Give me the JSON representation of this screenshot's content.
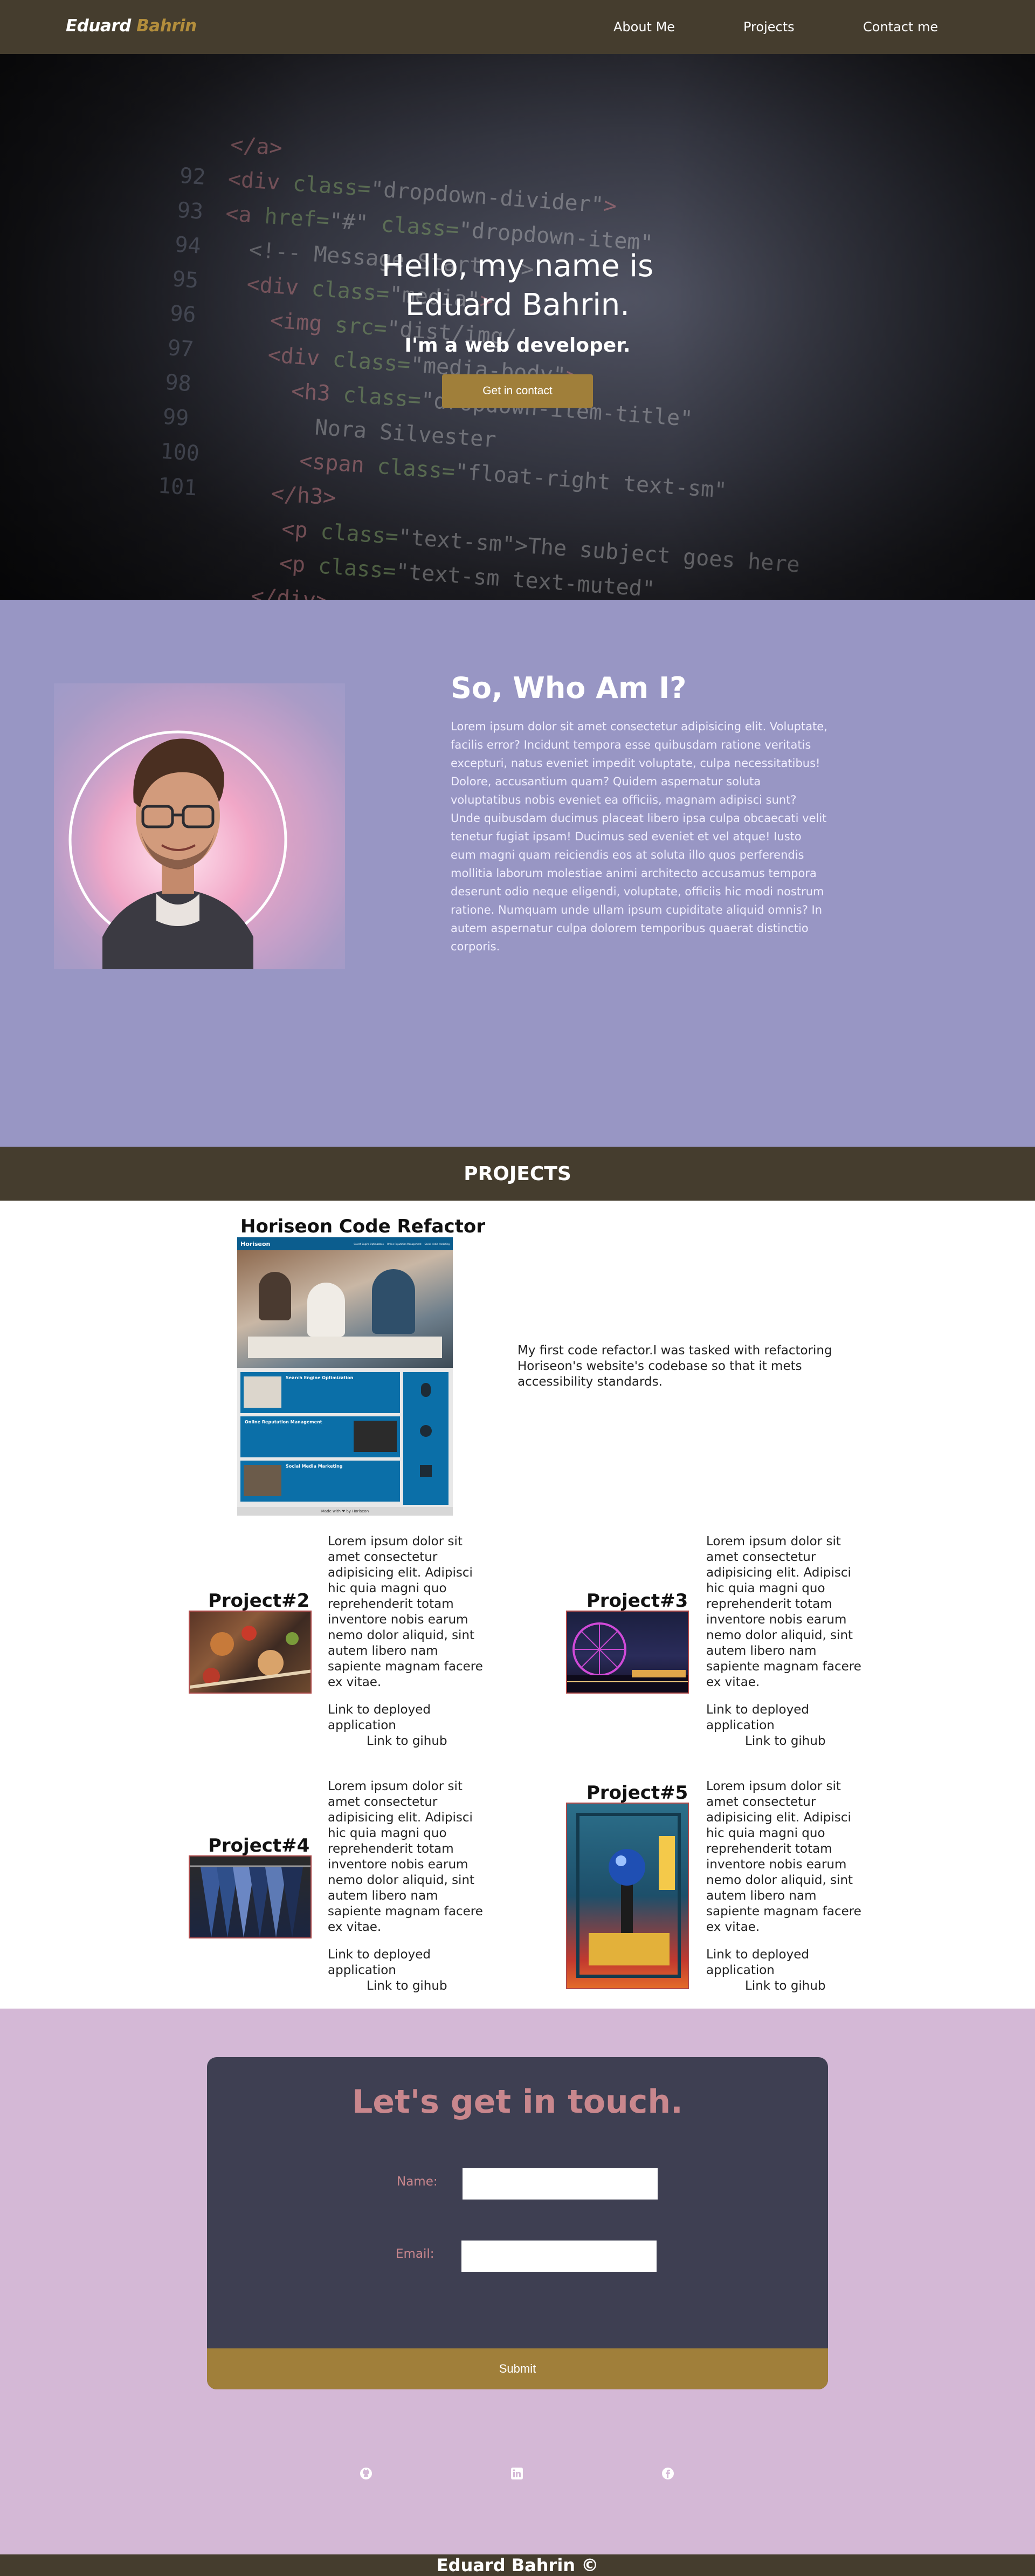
{
  "nav": {
    "brand_first": "Eduard",
    "brand_last": "Bahrin",
    "links": [
      "About Me",
      "Projects",
      "Contact me"
    ]
  },
  "hero": {
    "title_line1": "Hello, my name is",
    "title_line2": "Eduard Bahrin.",
    "subtitle": "I'm a web developer.",
    "cta": "Get in contact"
  },
  "about": {
    "title": "So, Who Am I?",
    "body": "Lorem ipsum dolor sit amet consectetur adipisicing elit. Voluptate, facilis error? Incidunt tempora esse quibusdam ratione veritatis excepturi, natus eveniet impedit voluptate, culpa necessitatibus! Dolore, accusantium quam? Quidem aspernatur soluta voluptatibus nobis eveniet ea officiis, magnam adipisci sunt? Unde quibusdam ducimus placeat libero ipsa culpa obcaecati velit tenetur fugiat ipsam! Ducimus sed eveniet et vel atque! Iusto eum magni quam reiciendis eos at soluta illo quos perferendis mollitia laborum molestiae animi architecto accusamus tempora deserunt odio neque eligendi, voluptate, officiis hic modi nostrum ratione. Numquam unde ullam ipsum cupiditate aliquid omnis? In autem aspernatur culpa dolorem temporibus quaerat distinctio corporis."
  },
  "projects": {
    "section_title": "PROJECTS",
    "featured": {
      "title": "Horiseon Code Refactor",
      "description": "My first code refactor.I was tasked with refactoring Horiseon's website's codebase so that it mets accessibility standards.",
      "screenshot": {
        "logo": "Horiseon",
        "nav": [
          "Search Engine Optimization",
          "Online Reputation Management",
          "Social Media Marketing"
        ],
        "cards": [
          "Search Engine Optimization",
          "Online Reputation Management",
          "Social Media Marketing"
        ],
        "footer": "Made with ❤ by Horiseon"
      }
    },
    "items": [
      {
        "title": "Project#2",
        "description": "Lorem ipsum dolor sit amet consectetur adipisicing elit. Adipisci hic quia magni quo reprehenderit totam inventore nobis earum nemo dolor aliquid, sint autem libero nam sapiente magnam facere ex vitae.",
        "link_deployed": "Link to deployed application",
        "link_github": "Link to gihub"
      },
      {
        "title": "Project#3",
        "description": "Lorem ipsum dolor sit amet consectetur adipisicing elit. Adipisci hic quia magni quo reprehenderit totam inventore nobis earum nemo dolor aliquid, sint autem libero nam sapiente magnam facere ex vitae.",
        "link_deployed": "Link to deployed application",
        "link_github": "Link to gihub"
      },
      {
        "title": "Project#4",
        "description": "Lorem ipsum dolor sit amet consectetur adipisicing elit. Adipisci hic quia magni quo reprehenderit totam inventore nobis earum nemo dolor aliquid, sint autem libero nam sapiente magnam facere ex vitae.",
        "link_deployed": "Link to deployed application",
        "link_github": "Link to gihub"
      },
      {
        "title": "Project#5",
        "description": "Lorem ipsum dolor sit amet consectetur adipisicing elit. Adipisci hic quia magni quo reprehenderit totam inventore nobis earum nemo dolor aliquid, sint autem libero nam sapiente magnam facere ex vitae.",
        "link_deployed": "Link to deployed application",
        "link_github": "Link to gihub"
      }
    ]
  },
  "contact": {
    "title": "Let's get in touch.",
    "name_label": "Name:",
    "email_label": "Email:",
    "submit": "Submit",
    "social_icons": [
      "github-icon",
      "linkedin-icon",
      "facebook-icon"
    ]
  },
  "footer": {
    "text": "Eduard Bahrin ©"
  },
  "colors": {
    "nav_bg": "#453d2e",
    "accent_gold": "#a07f3a",
    "about_bg": "#9896c4",
    "contact_bg": "#d4b8d6",
    "card_bg": "#3e3f52",
    "contact_text": "#c9878d"
  }
}
